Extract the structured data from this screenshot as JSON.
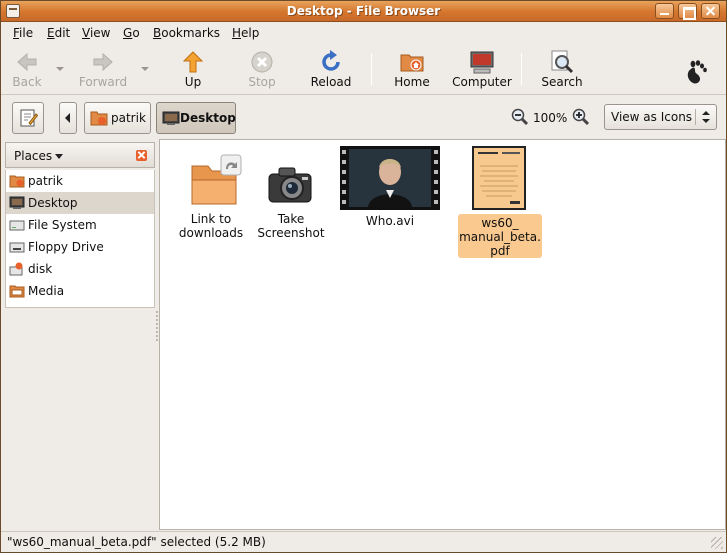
{
  "window": {
    "title": "Desktop - File Browser"
  },
  "menu": [
    "File",
    "Edit",
    "View",
    "Go",
    "Bookmarks",
    "Help"
  ],
  "toolbar": {
    "back": "Back",
    "forward": "Forward",
    "up": "Up",
    "stop": "Stop",
    "reload": "Reload",
    "home": "Home",
    "computer": "Computer",
    "search": "Search"
  },
  "location": {
    "crumbs": [
      "patrik",
      "Desktop"
    ],
    "zoom": "100%",
    "view_mode": "View as Icons"
  },
  "sidebar": {
    "header": "Places",
    "items": [
      {
        "label": "patrik",
        "icon": "home-folder-icon"
      },
      {
        "label": "Desktop",
        "icon": "desktop-icon",
        "selected": true
      },
      {
        "label": "File System",
        "icon": "drive-icon"
      },
      {
        "label": "Floppy Drive",
        "icon": "floppy-icon"
      },
      {
        "label": "disk",
        "icon": "disk-icon"
      },
      {
        "label": "Media",
        "icon": "media-icon"
      }
    ]
  },
  "files": [
    {
      "line1": "Link to",
      "line2": "downloads",
      "line3": "",
      "icon": "folder-link-icon"
    },
    {
      "line1": "Take",
      "line2": "Screenshot",
      "line3": "",
      "icon": "camera-icon"
    },
    {
      "line1": "Who.avi",
      "line2": "",
      "line3": "",
      "icon": "video-thumbnail"
    },
    {
      "line1": "ws60_",
      "line2": "manual_beta.",
      "line3": "pdf",
      "icon": "pdf-thumbnail",
      "selected": true
    }
  ],
  "status": "\"ws60_manual_beta.pdf\" selected (5.2 MB)",
  "colors": {
    "titlebar": "#d5762e",
    "selection": "#f9c98f",
    "sidebar_selection": "#ddd6cc",
    "folder": "#f0a55a"
  }
}
